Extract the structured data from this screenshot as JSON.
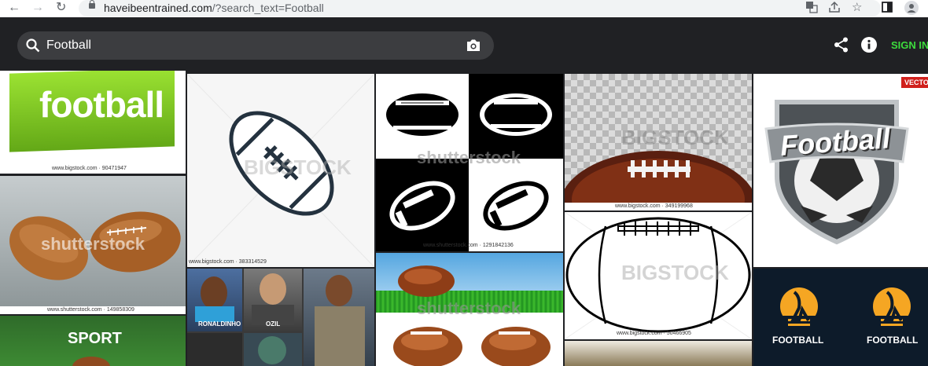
{
  "browser": {
    "url_domain": "haveibeentrained.com",
    "url_path": "/?search_text=Football"
  },
  "app": {
    "search_value": "Football",
    "sign_in_label": "SIGN IN"
  },
  "results": {
    "t1": {
      "text": "football",
      "credit": "www.bigstock.com · 90471947"
    },
    "t2": {
      "credit": "www.shutterstock.com · 149858309",
      "watermark": "shutterstock"
    },
    "t3": {
      "text": "SPORT"
    },
    "t4": {
      "credit": "www.bigstock.com · 383314529",
      "watermark": "BIGSTOCK"
    },
    "t5": {
      "captions": [
        "RONALDINHO",
        "OZIL"
      ]
    },
    "t6": {
      "credit": "www.shutterstock.com · 1291842136",
      "watermark": "shutterstock"
    },
    "t7": {
      "watermark": "shutterstock"
    },
    "t8": {
      "credit": "www.bigstock.com · 349199968",
      "watermark": "BIGSTOCK"
    },
    "t9": {
      "credit": "www.bigstock.com · 50466905",
      "watermark": "BIGSTOCK"
    },
    "t10": {
      "text": "Football",
      "ribbon": "VECTO"
    },
    "t11": {
      "labels": [
        "FOOTBALL",
        "FOOTBALL"
      ]
    }
  },
  "icons": [
    "back-arrow-icon",
    "forward-arrow-icon",
    "reload-icon",
    "lock-icon",
    "translate-icon",
    "share-page-icon",
    "bookmark-star-icon",
    "side-panel-icon",
    "profile-icon",
    "search-icon",
    "camera-icon",
    "share-icon",
    "info-icon"
  ],
  "colors": {
    "accent": "#3ddc3d",
    "header": "#202124",
    "search_box": "#3c3d40"
  }
}
